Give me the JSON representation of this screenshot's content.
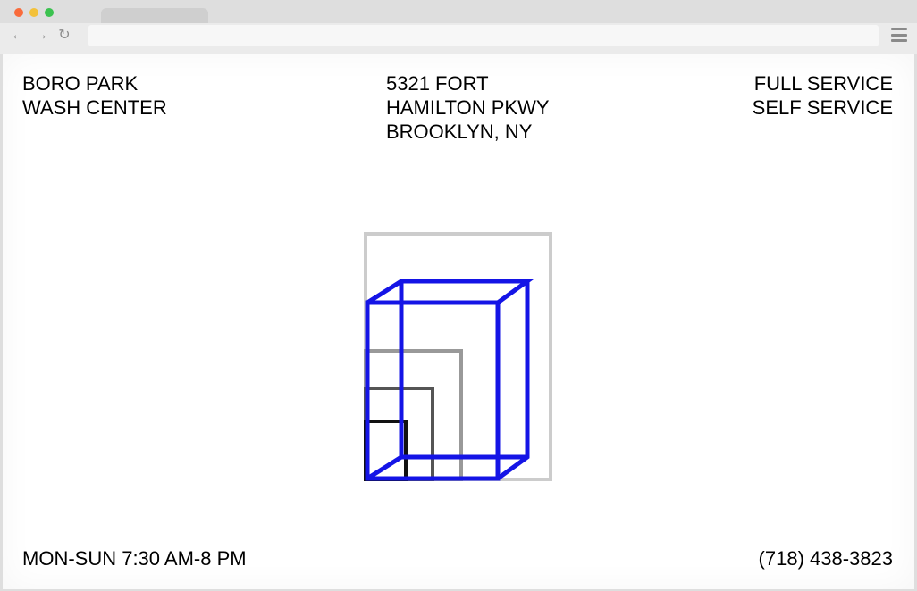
{
  "browser": {
    "url": ""
  },
  "header": {
    "name_lines": [
      "BORO PARK",
      "WASH CENTER"
    ],
    "address_lines": [
      "5321 FORT",
      "HAMILTON PKWY",
      "BROOKLYN, NY"
    ],
    "service_lines": [
      "FULL SERVICE",
      "SELF SERVICE"
    ]
  },
  "footer": {
    "hours": "MON-SUN 7:30 AM-8 PM",
    "phone": "(718) 438-3823"
  },
  "colors": {
    "accent": "#1414e6",
    "light_gray": "#cccccc",
    "mid_gray": "#999999",
    "dark_gray": "#555555",
    "black": "#111111"
  },
  "icons": {
    "logo": "nested-cube-logo",
    "back": "back-arrow-icon",
    "forward": "forward-arrow-icon",
    "reload": "reload-icon",
    "menu": "hamburger-menu-icon"
  }
}
